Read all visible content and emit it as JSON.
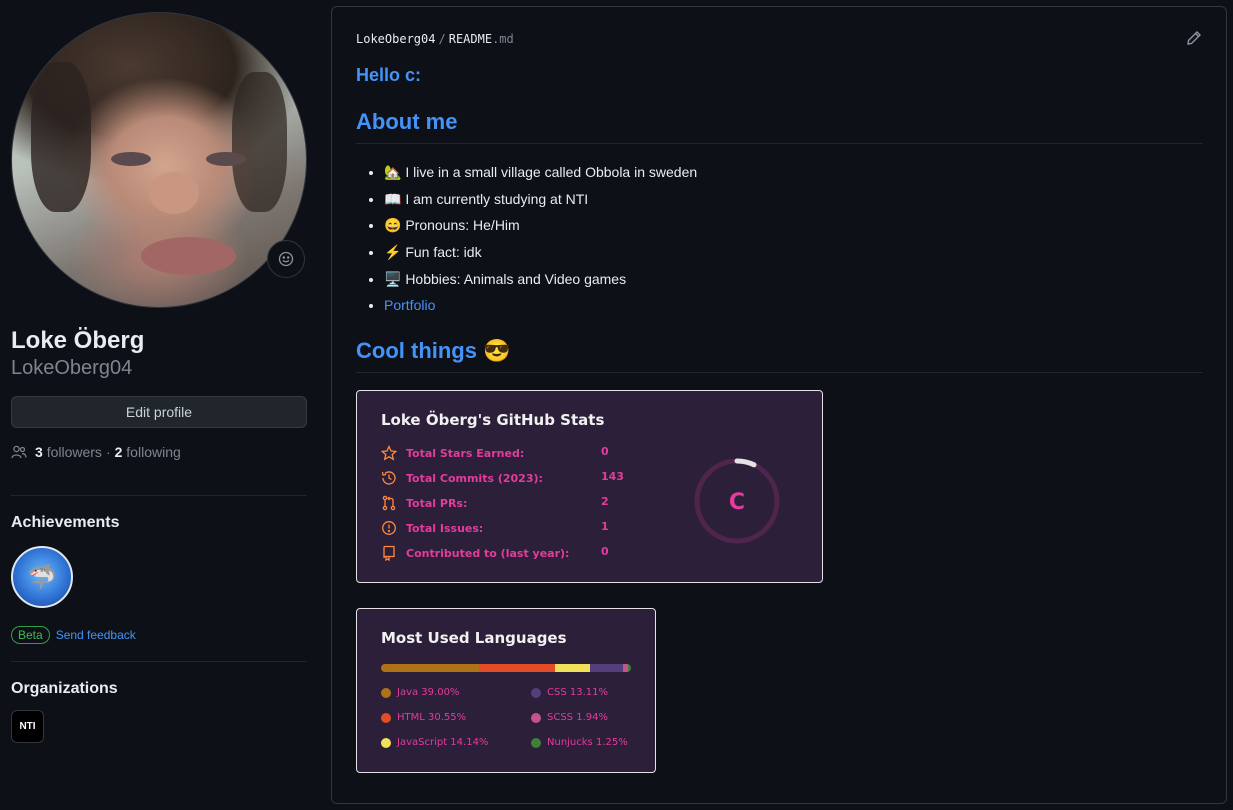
{
  "profile": {
    "name": "Loke Öberg",
    "username": "LokeOberg04",
    "edit_label": "Edit profile",
    "followers_count": "3",
    "followers_label": "followers",
    "separator": "·",
    "following_count": "2",
    "following_label": "following"
  },
  "achievements": {
    "title": "Achievements",
    "beta_label": "Beta",
    "feedback_label": "Send feedback"
  },
  "organizations": {
    "title": "Organizations",
    "org_text": "NTI"
  },
  "readme": {
    "owner": "LokeOberg04",
    "slash": "/",
    "file": "README",
    "ext": ".md",
    "hello": "Hello c:",
    "about_heading": "About me",
    "items": [
      "🏡 I live in a small village called Obbola in sweden",
      "📖 I am currently studying at NTI",
      "😄 Pronouns: He/Him",
      "⚡ Fun fact: idk",
      "🖥️ Hobbies: Animals and Video games"
    ],
    "portfolio_link": "Portfolio",
    "cool_heading": "Cool things 😎"
  },
  "stats_card": {
    "title": "Loke Öberg's GitHub Stats",
    "rows": [
      {
        "label": "Total Stars Earned:",
        "value": "0"
      },
      {
        "label": "Total Commits (2023):",
        "value": "143"
      },
      {
        "label": "Total PRs:",
        "value": "2"
      },
      {
        "label": "Total Issues:",
        "value": "1"
      },
      {
        "label": "Contributed to (last year):",
        "value": "0"
      }
    ],
    "rank": "C",
    "rank_progress": 0.07,
    "title_color": "#f1f1f1",
    "text_color": "#e33c9a",
    "icon_color": "#ff8a3d",
    "bg_color": "#2b1f3a"
  },
  "languages_card": {
    "title": "Most Used Languages",
    "languages": [
      {
        "name": "Java",
        "percent": "39.00%",
        "value": 39.0,
        "color": "#b07219"
      },
      {
        "name": "HTML",
        "percent": "30.55%",
        "value": 30.55,
        "color": "#e34c26"
      },
      {
        "name": "JavaScript",
        "percent": "14.14%",
        "value": 14.14,
        "color": "#f1e05a"
      },
      {
        "name": "CSS",
        "percent": "13.11%",
        "value": 13.11,
        "color": "#563d7c"
      },
      {
        "name": "SCSS",
        "percent": "1.94%",
        "value": 1.94,
        "color": "#c6538c"
      },
      {
        "name": "Nunjucks",
        "percent": "1.25%",
        "value": 1.25,
        "color": "#3d8137"
      }
    ]
  }
}
